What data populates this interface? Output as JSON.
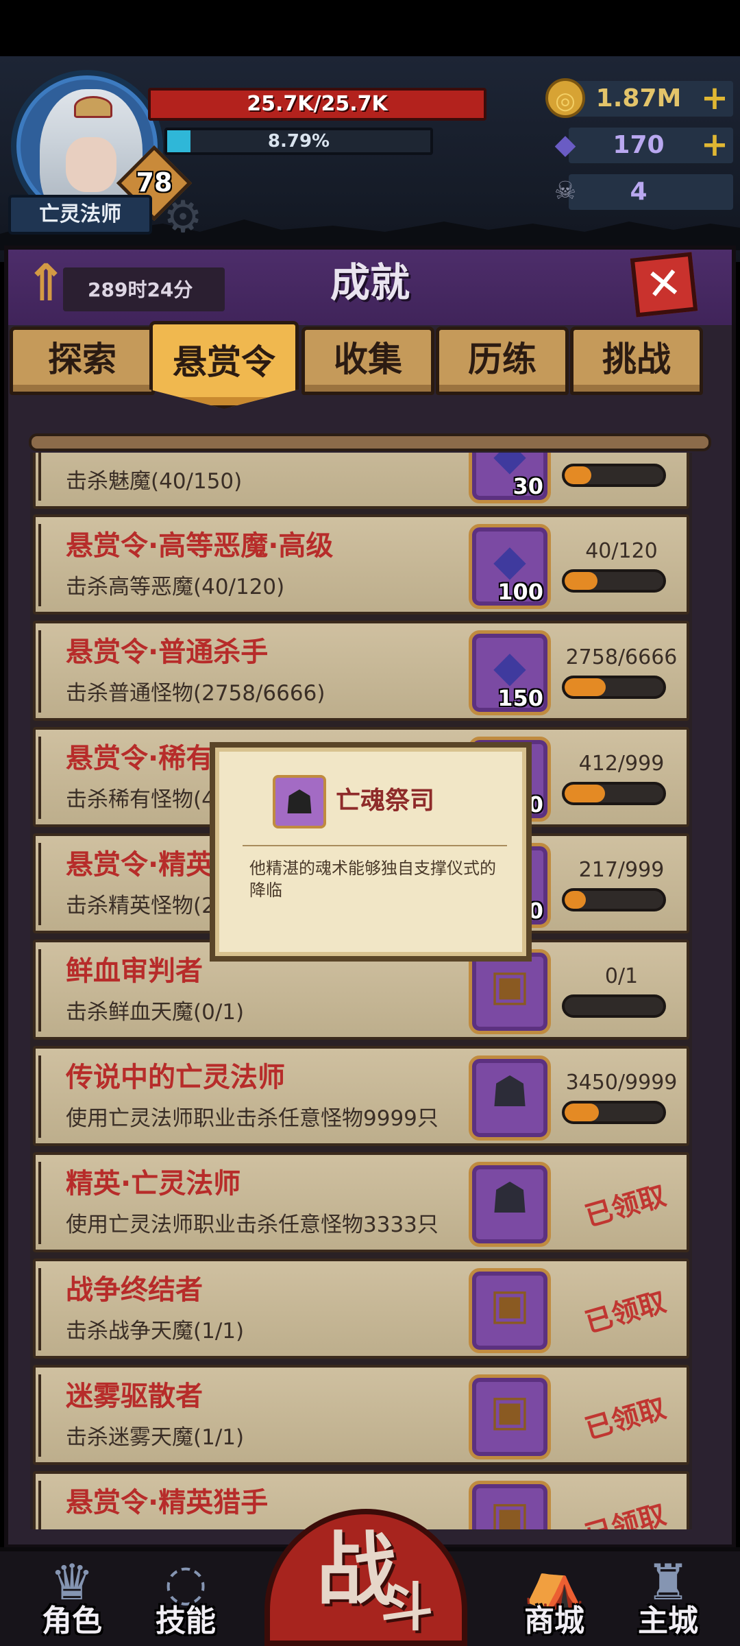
{
  "player": {
    "class_name": "亡灵法师",
    "level": "78",
    "hp_text": "25.7K/25.7K",
    "xp_text": "8.79%",
    "xp_percent": 8.79
  },
  "resources": {
    "gold": "1.87M",
    "gems": "170",
    "tokens": "4",
    "plus": "+"
  },
  "panel": {
    "title": "成就",
    "timer": "289时24分",
    "close_label": "✕"
  },
  "tabs": [
    "探索",
    "悬赏令",
    "收集",
    "历练",
    "挑战"
  ],
  "active_tab": 1,
  "achievements": [
    {
      "title": "",
      "desc": "击杀魅魔(40/150)",
      "reward_icon": "gem-icon",
      "reward_count": "30",
      "progress_label": "",
      "progress": 0.27,
      "claimed": false
    },
    {
      "title": "悬赏令·高等恶魔·高级",
      "desc": "击杀高等恶魔(40/120)",
      "reward_icon": "gem-icon",
      "reward_count": "100",
      "progress_label": "40/120",
      "progress": 0.333,
      "claimed": false
    },
    {
      "title": "悬赏令·普通杀手",
      "desc": "击杀普通怪物(2758/6666)",
      "reward_icon": "gem-icon",
      "reward_count": "150",
      "progress_label": "2758/6666",
      "progress": 0.414,
      "claimed": false
    },
    {
      "title": "悬赏令·稀有杀手",
      "desc": "击杀稀有怪物(412/999)",
      "reward_icon": "gem-icon",
      "reward_count": "50",
      "progress_label": "412/999",
      "progress": 0.412,
      "claimed": false
    },
    {
      "title": "悬赏令·精英",
      "desc": "击杀精英怪物(217/999)",
      "reward_icon": "gem-icon",
      "reward_count": "50",
      "progress_label": "217/999",
      "progress": 0.217,
      "claimed": false
    },
    {
      "title": "鲜血审判者",
      "desc": "击杀鲜血天魔(0/1)",
      "reward_icon": "chest-icon",
      "reward_count": "",
      "progress_label": "0/1",
      "progress": 0,
      "claimed": false
    },
    {
      "title": "传说中的亡灵法师",
      "desc": "使用亡灵法师职业击杀任意怪物9999只",
      "reward_icon": "hero-icon",
      "reward_count": "",
      "progress_label": "3450/9999",
      "progress": 0.345,
      "claimed": false
    },
    {
      "title": "精英·亡灵法师",
      "desc": "使用亡灵法师职业击杀任意怪物3333只",
      "reward_icon": "hero-icon",
      "reward_count": "",
      "progress_label": "",
      "progress": 1,
      "claimed": true
    },
    {
      "title": "战争终结者",
      "desc": "击杀战争天魔(1/1)",
      "reward_icon": "chest-icon",
      "reward_count": "",
      "progress_label": "",
      "progress": 1,
      "claimed": true
    },
    {
      "title": "迷雾驱散者",
      "desc": "击杀迷雾天魔(1/1)",
      "reward_icon": "chest-icon",
      "reward_count": "",
      "progress_label": "",
      "progress": 1,
      "claimed": true
    },
    {
      "title": "悬赏令·精英猎手",
      "desc": "",
      "reward_icon": "chest-icon",
      "reward_count": "",
      "progress_label": "",
      "progress": 1,
      "claimed": true
    }
  ],
  "claimed_label": "已领取",
  "tooltip": {
    "name": "亡魂祭司",
    "desc": "他精湛的魂术能够独自支撑仪式的降临"
  },
  "nav": {
    "role": "角色",
    "skills": "技能",
    "battle_1": "战",
    "battle_2": "斗",
    "shop": "商城",
    "city": "主城"
  }
}
